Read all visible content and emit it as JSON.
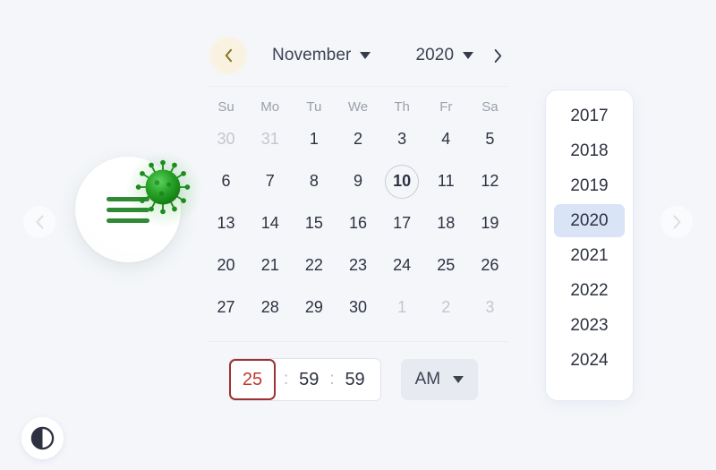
{
  "background_color": "#f4f6fa",
  "nav": {
    "prev_slide_icon": "chevron-left-icon",
    "next_slide_icon": "chevron-right-icon"
  },
  "theme_toggle": {
    "icon": "contrast-circle-icon",
    "label": "Contrast"
  },
  "illustration": {
    "menu_icon": "hamburger-menu-icon",
    "virus_icon": "virus-icon",
    "accent_color": "#2f8a33"
  },
  "calendar": {
    "prev_month_icon": "chevron-left-icon",
    "next_month_icon": "chevron-right-icon",
    "prev_focus_color": "#faf2e0",
    "month": "November",
    "year": "2020",
    "month_caret_icon": "chevron-down-icon",
    "year_caret_icon": "chevron-down-icon",
    "weekdays": [
      "Su",
      "Mo",
      "Tu",
      "We",
      "Th",
      "Fr",
      "Sa"
    ],
    "today": "10",
    "weeks": [
      [
        {
          "d": "30",
          "muted": true
        },
        {
          "d": "31",
          "muted": true
        },
        {
          "d": "1"
        },
        {
          "d": "2"
        },
        {
          "d": "3"
        },
        {
          "d": "4"
        },
        {
          "d": "5"
        }
      ],
      [
        {
          "d": "6"
        },
        {
          "d": "7"
        },
        {
          "d": "8"
        },
        {
          "d": "9"
        },
        {
          "d": "10",
          "today": true
        },
        {
          "d": "11"
        },
        {
          "d": "12"
        }
      ],
      [
        {
          "d": "13"
        },
        {
          "d": "14"
        },
        {
          "d": "15"
        },
        {
          "d": "16"
        },
        {
          "d": "17"
        },
        {
          "d": "18"
        },
        {
          "d": "19"
        }
      ],
      [
        {
          "d": "20"
        },
        {
          "d": "21"
        },
        {
          "d": "22"
        },
        {
          "d": "23"
        },
        {
          "d": "24"
        },
        {
          "d": "25"
        },
        {
          "d": "26"
        }
      ],
      [
        {
          "d": "27"
        },
        {
          "d": "28"
        },
        {
          "d": "29"
        },
        {
          "d": "30"
        },
        {
          "d": "1",
          "muted": true
        },
        {
          "d": "2",
          "muted": true
        },
        {
          "d": "3",
          "muted": true
        }
      ]
    ]
  },
  "time": {
    "hour": "25",
    "minute": "59",
    "second": "59",
    "separator": ":",
    "hour_invalid": true,
    "hour_error_border_color": "#9e3232",
    "hour_error_text_color": "#c0392b",
    "meridiem": "AM",
    "meridiem_caret_icon": "chevron-down-icon"
  },
  "year_dropdown": {
    "selected": "2020",
    "highlight_color": "#d9e4f7",
    "options": [
      "2017",
      "2018",
      "2019",
      "2020",
      "2021",
      "2022",
      "2023",
      "2024"
    ]
  }
}
